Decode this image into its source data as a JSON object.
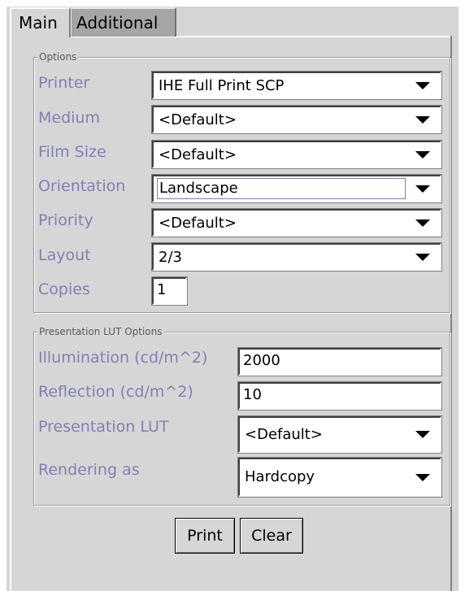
{
  "tabs": [
    {
      "label": "Main"
    },
    {
      "label": "Additional"
    }
  ],
  "options": {
    "group_title": "Options",
    "printer": {
      "label": "Printer",
      "value": "IHE Full Print SCP"
    },
    "medium": {
      "label": "Medium",
      "value": "<Default>"
    },
    "film_size": {
      "label": "Film Size",
      "value": "<Default>"
    },
    "orientation": {
      "label": "Orientation",
      "value": "Landscape"
    },
    "priority": {
      "label": "Priority",
      "value": "<Default>"
    },
    "layout": {
      "label": "Layout",
      "value": "2/3"
    },
    "copies": {
      "label": "Copies",
      "value": "1"
    }
  },
  "lut": {
    "group_title": "Presentation LUT Options",
    "illumination": {
      "label": "Illumination (cd/m^2)",
      "value": "2000"
    },
    "reflection": {
      "label": "Reflection (cd/m^2)",
      "value": "10"
    },
    "presentation_lut": {
      "label": "Presentation LUT",
      "value": "<Default>"
    },
    "rendering_as": {
      "label": "Rendering as",
      "value": "Hardcopy"
    }
  },
  "buttons": {
    "print": "Print",
    "clear": "Clear"
  }
}
